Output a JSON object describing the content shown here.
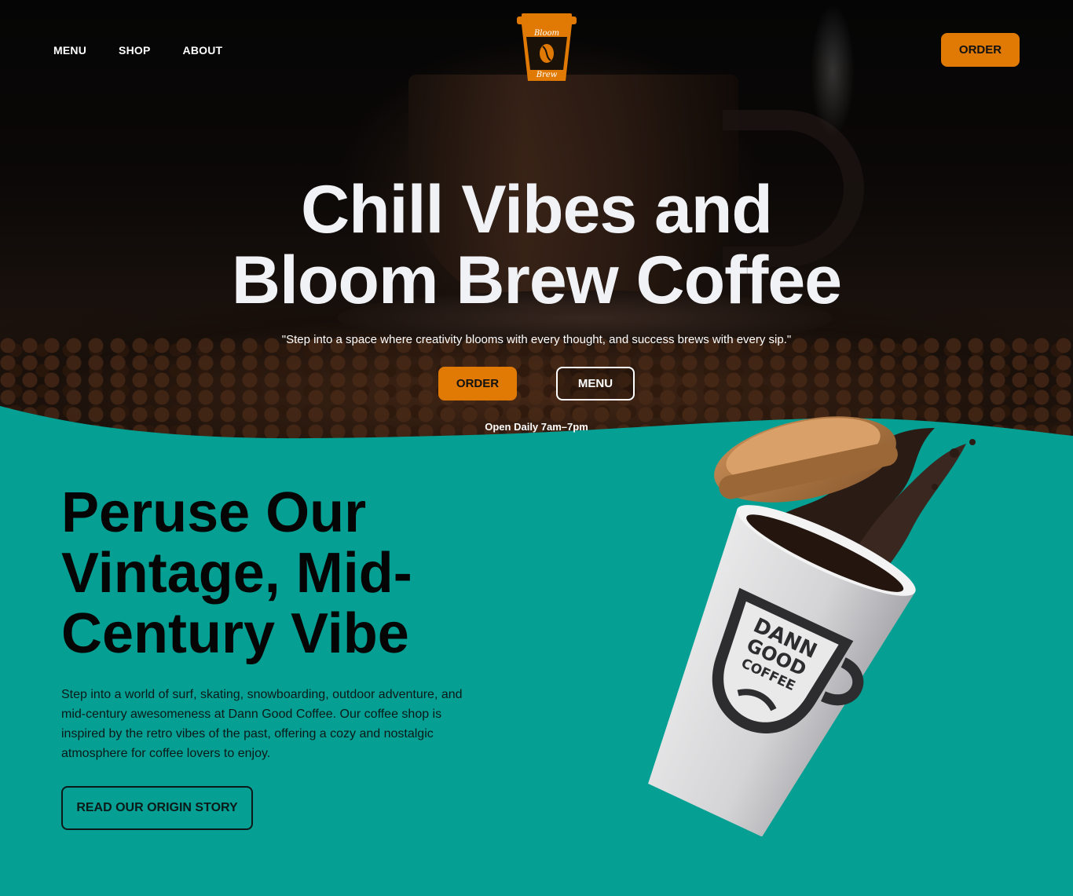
{
  "nav": {
    "links": [
      "MENU",
      "SHOP",
      "ABOUT"
    ],
    "order_label": "ORDER"
  },
  "logo": {
    "top_text": "Bloom",
    "bottom_text": "Brew",
    "color": "#e17a04"
  },
  "hero": {
    "title_line1": "Chill Vibes and",
    "title_line2": "Bloom Brew Coffee",
    "quote": "\"Step into a space where creativity blooms with every thought, and success brews with every sip.\"",
    "order_label": "ORDER",
    "menu_label": "MENU",
    "hours": "Open Daily 7am–7pm"
  },
  "section": {
    "title_line1": "Peruse Our",
    "title_line2": "Vintage, Mid-",
    "title_line3": "Century Vibe",
    "body": "Step into a world of surf, skating, snowboarding, outdoor adventure, and mid-century awesomeness at Dann Good Coffee. Our coffee shop is inspired by the retro vibes of the past, offering a cozy and nostalgic atmosphere for coffee lovers to enjoy.",
    "button_label": "READ OUR ORIGIN STORY",
    "cup_brand_line1": "DANN",
    "cup_brand_line2": "GOOD",
    "cup_brand_line3": "COFFEE"
  },
  "colors": {
    "accent": "#e17a04",
    "teal": "#05a093",
    "hero_text": "#f1f2f5"
  }
}
